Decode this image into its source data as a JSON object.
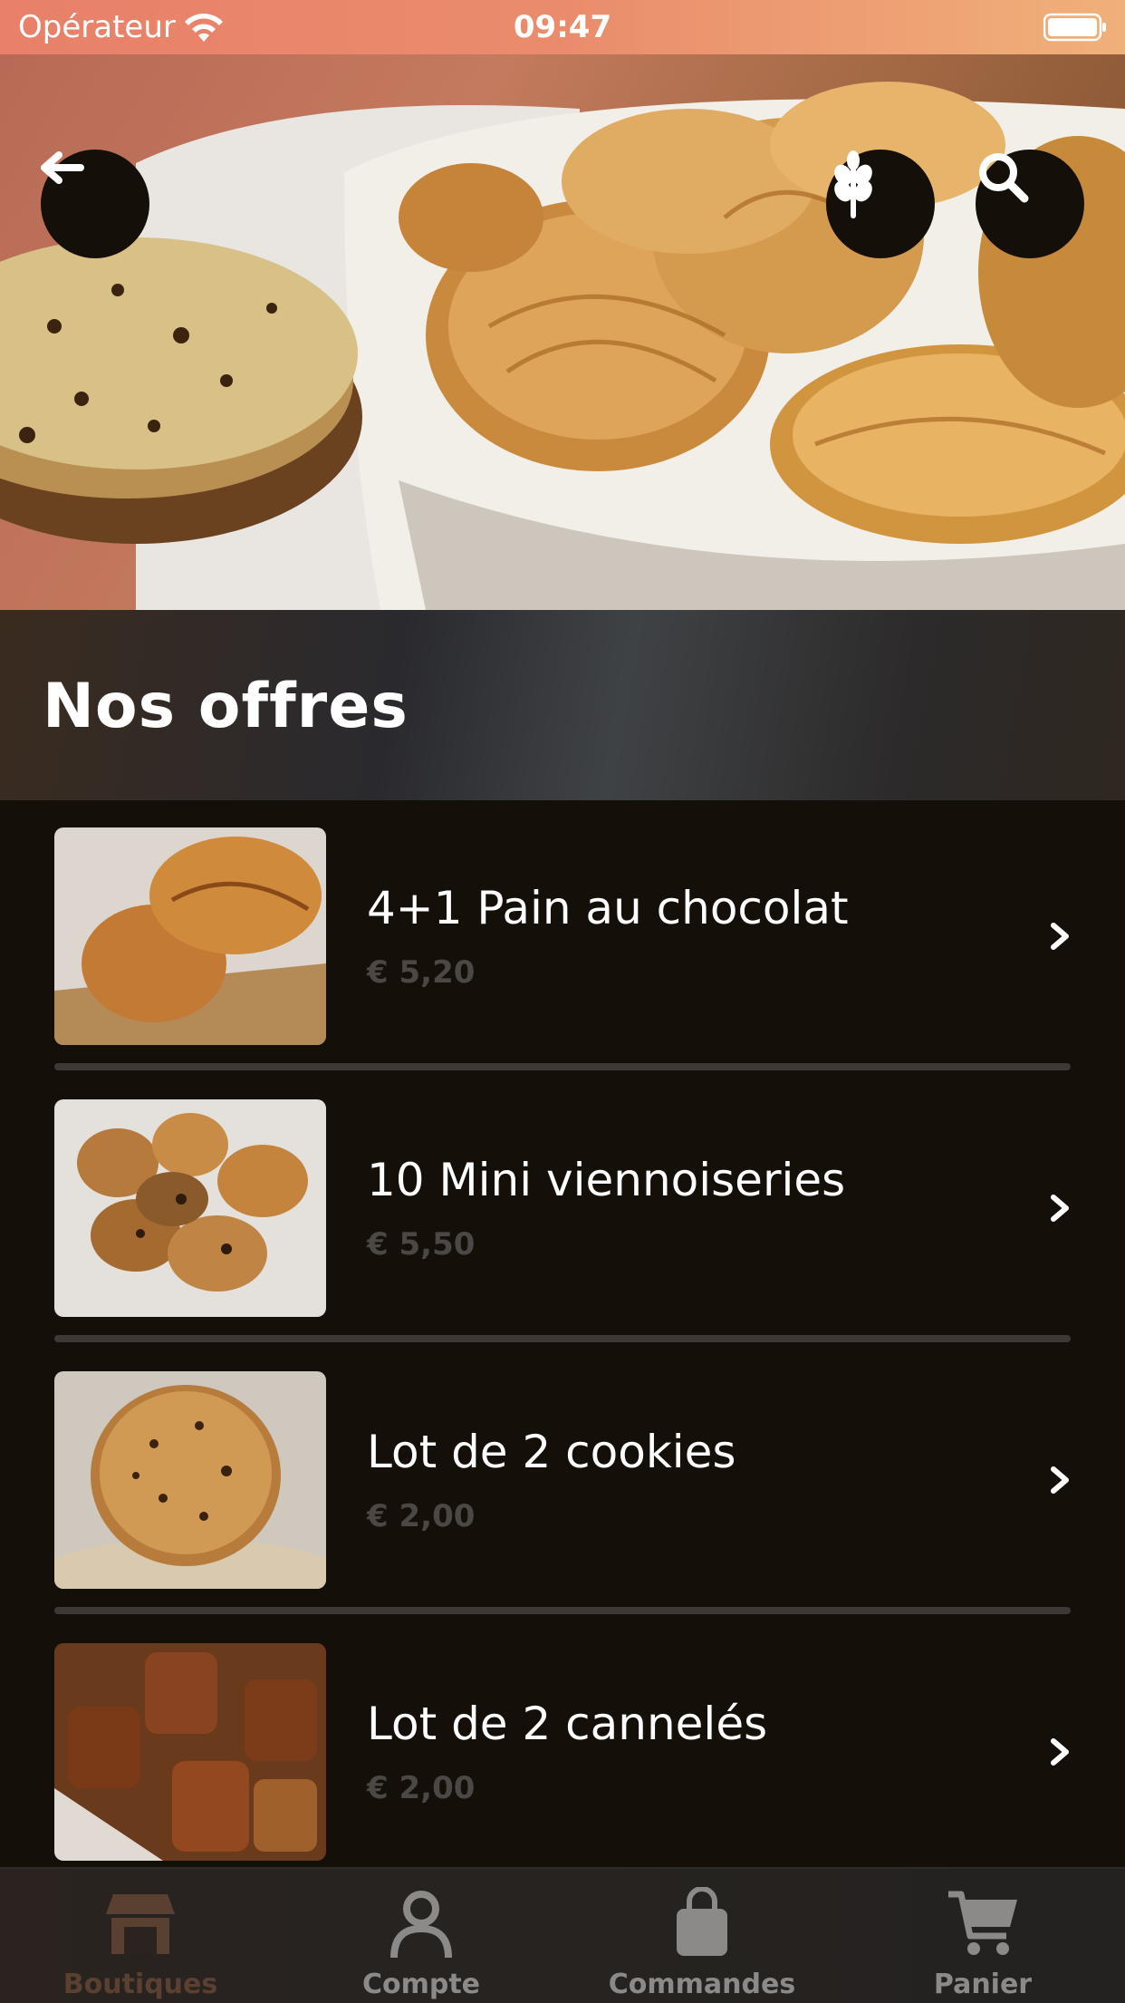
{
  "status_bar": {
    "carrier": "Opérateur",
    "time": "09:47"
  },
  "header": {
    "back_icon": "arrow-left-icon",
    "grain_icon": "wheat-icon",
    "search_icon": "search-icon"
  },
  "page": {
    "title": "Nos offres"
  },
  "offers": [
    {
      "name": "4+1 Pain au chocolat",
      "price": "€ 5,20"
    },
    {
      "name": "10 Mini viennoiseries",
      "price": "€ 5,50"
    },
    {
      "name": "Lot de 2 cookies",
      "price": "€ 2,00"
    },
    {
      "name": "Lot de 2 cannelés",
      "price": "€ 2,00"
    }
  ],
  "tabs": [
    {
      "label": "Boutiques",
      "icon": "store-icon",
      "active": true
    },
    {
      "label": "Compte",
      "icon": "user-icon",
      "active": false
    },
    {
      "label": "Commandes",
      "icon": "bag-icon",
      "active": false
    },
    {
      "label": "Panier",
      "icon": "cart-icon",
      "active": false
    }
  ],
  "colors": {
    "background": "#140f09",
    "status_bar": "#ea8c6c",
    "text_muted": "#4b4744",
    "accent_active_tab": "#5a4030"
  }
}
